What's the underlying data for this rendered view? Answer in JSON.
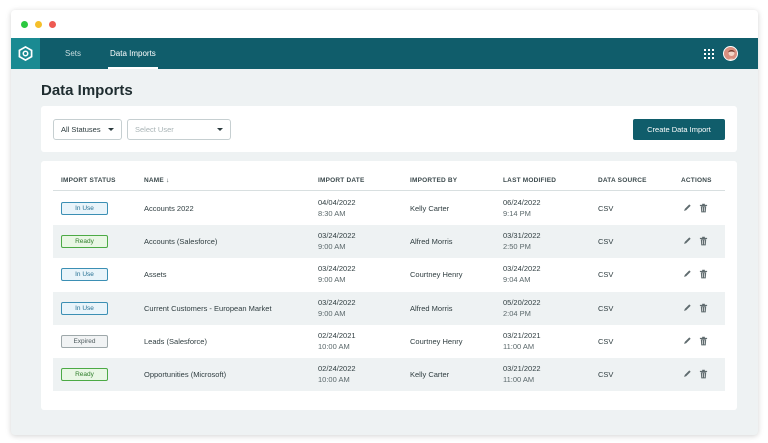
{
  "window": {
    "controls": [
      "close",
      "minimize",
      "maximize"
    ]
  },
  "nav": {
    "logo_icon": "logo-icon",
    "items": [
      {
        "label": "Sets",
        "active": false
      },
      {
        "label": "Data Imports",
        "active": true
      }
    ],
    "apps_icon": "grid-icon",
    "avatar_icon": "avatar"
  },
  "page": {
    "title": "Data Imports"
  },
  "filters": {
    "status_value": "All Statuses",
    "user_placeholder": "Select User",
    "create_label": "Create Data Import"
  },
  "table": {
    "headers": {
      "status": "IMPORT STATUS",
      "name": "NAME",
      "sort_icon": "↓",
      "date": "IMPORT DATE",
      "by": "IMPORTED BY",
      "modified": "LAST MODIFIED",
      "source": "DATA SOURCE",
      "actions": "ACTIONS"
    },
    "rows": [
      {
        "status": "In Use",
        "status_type": "inuse",
        "name": "Accounts 2022",
        "import_date": "04/04/2022",
        "import_time": "8:30 AM",
        "imported_by": "Kelly Carter",
        "modified_date": "06/24/2022",
        "modified_time": "9:14 PM",
        "source": "CSV"
      },
      {
        "status": "Ready",
        "status_type": "ready",
        "name": "Accounts (Salesforce)",
        "import_date": "03/24/2022",
        "import_time": "9:00 AM",
        "imported_by": "Alfred Morris",
        "modified_date": "03/31/2022",
        "modified_time": "2:50 PM",
        "source": "CSV"
      },
      {
        "status": "In Use",
        "status_type": "inuse",
        "name": "Assets",
        "import_date": "03/24/2022",
        "import_time": "9:00 AM",
        "imported_by": "Courtney Henry",
        "modified_date": "03/24/2022",
        "modified_time": "9:04 AM",
        "source": "CSV"
      },
      {
        "status": "In Use",
        "status_type": "inuse",
        "name": "Current Customers - European Market",
        "import_date": "03/24/2022",
        "import_time": "9:00 AM",
        "imported_by": "Alfred Morris",
        "modified_date": "05/20/2022",
        "modified_time": "2:04 PM",
        "source": "CSV"
      },
      {
        "status": "Expired",
        "status_type": "expired",
        "name": "Leads (Salesforce)",
        "import_date": "02/24/2021",
        "import_time": "10:00 AM",
        "imported_by": "Courtney Henry",
        "modified_date": "03/21/2021",
        "modified_time": "11:00 AM",
        "source": "CSV"
      },
      {
        "status": "Ready",
        "status_type": "ready",
        "name": "Opportunities (Microsoft)",
        "import_date": "02/24/2022",
        "import_time": "10:00 AM",
        "imported_by": "Kelly Carter",
        "modified_date": "03/21/2022",
        "modified_time": "11:00 AM",
        "source": "CSV"
      }
    ],
    "row_actions": [
      "edit-icon",
      "trash-icon"
    ]
  },
  "colors": {
    "brand": "#105d6b",
    "logo_bg": "#1a8a92",
    "page_bg": "#eef2f3",
    "in_use": "#3b8fb4",
    "ready": "#4caa45",
    "expired": "#9ea8aa"
  }
}
